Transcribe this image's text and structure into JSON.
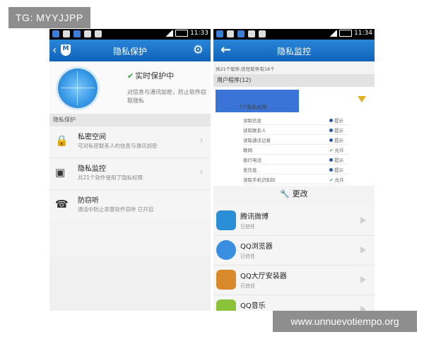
{
  "watermarks": {
    "top_left": "TG: MYYJJPP",
    "bottom_right": "www.unnuevotiempo.org"
  },
  "left_phone": {
    "status_time": "11:33",
    "title": "隐私保护",
    "hero": {
      "status": "实时保护中",
      "description": "对信息与通讯加密，防止软件窃取隐私"
    },
    "section_header": "隐私保护",
    "items": [
      {
        "title": "私密空间",
        "subtitle": "可对私密联系人的信息与通讯加密",
        "icon": "lock-icon"
      },
      {
        "title": "隐私监控",
        "subtitle": "共21个软件使用了隐私权限",
        "icon": "monitor-icon"
      },
      {
        "title": "防窃听",
        "subtitle": "通话中防止恶意软件窃听 已开启",
        "icon": "phone-lock-icon"
      }
    ],
    "colors": {
      "titlebar": "#1a73c8",
      "ok": "#3aa43a"
    }
  },
  "right_phone": {
    "status_time": "11:34",
    "title": "隐私监控",
    "info_line": "共21个软件,信任软件有16个",
    "group_header": "用户程序(12)",
    "perm_count": "7个隐私权限",
    "permissions": [
      {
        "name": "读取信息",
        "status": "提示",
        "kind": "prompt"
      },
      {
        "name": "读取联系人",
        "status": "提示",
        "kind": "prompt"
      },
      {
        "name": "读取通话记录",
        "status": "提示",
        "kind": "prompt"
      },
      {
        "name": "联网",
        "status": "允许",
        "kind": "allow"
      },
      {
        "name": "拨打电话",
        "status": "提示",
        "kind": "prompt"
      },
      {
        "name": "发信息",
        "status": "提示",
        "kind": "prompt"
      },
      {
        "name": "读取手机识别码",
        "status": "允许",
        "kind": "allow"
      }
    ],
    "change_label": "更改",
    "apps": [
      {
        "name": "腾讯微博",
        "status": "已信任",
        "color": "#2b8fd6"
      },
      {
        "name": "QQ浏览器",
        "status": "已信任",
        "color": "#3a8ee0"
      },
      {
        "name": "QQ大厅安装器",
        "status": "已信任",
        "color": "#d8892a"
      },
      {
        "name": "QQ音乐",
        "status": "",
        "color": "#8ac33a"
      }
    ]
  }
}
